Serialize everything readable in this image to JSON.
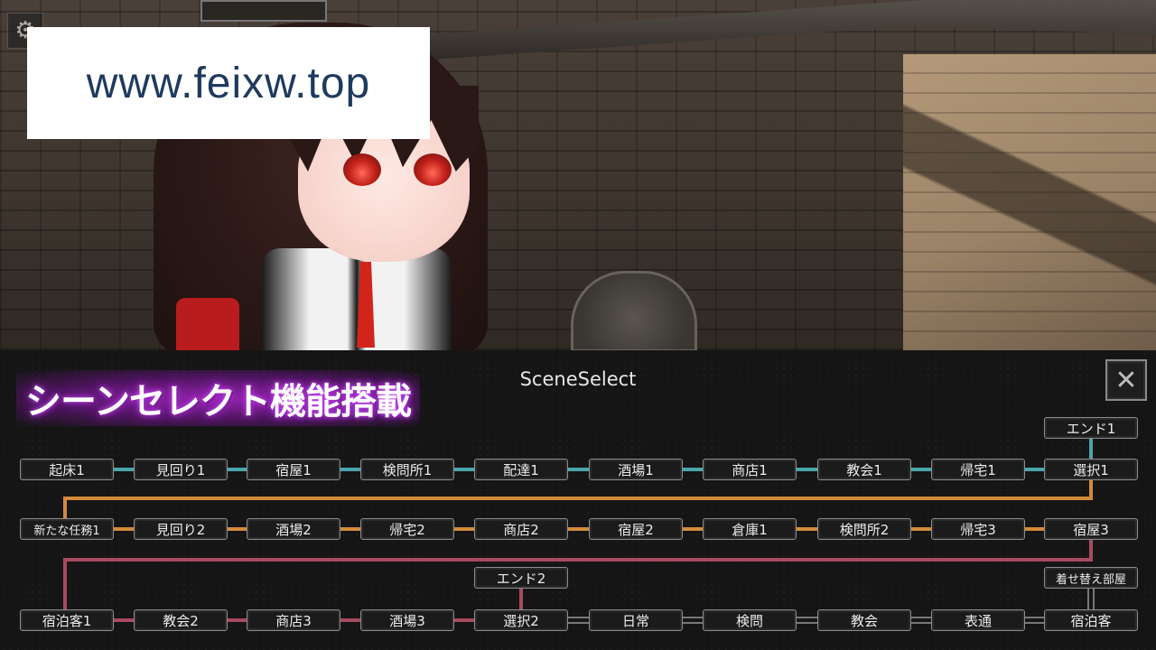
{
  "watermark": "www.feixw.top",
  "promo_banner": "シーンセレクト機能搭載",
  "panel": {
    "title": "SceneSelect",
    "close_symbol": "✕",
    "settings_symbol": "⚙"
  },
  "colors": {
    "row1_link": "#4aa6ad",
    "row2_link": "#d48a3a",
    "row3_link": "#a84a60",
    "neutral_link": "#9a9a9a"
  },
  "rows": {
    "row1": [
      "起床1",
      "見回り1",
      "宿屋1",
      "検問所1",
      "配達1",
      "酒場1",
      "商店1",
      "教会1",
      "帰宅1",
      "選択1"
    ],
    "row2": [
      "新たな任務1",
      "見回り2",
      "酒場2",
      "帰宅2",
      "商店2",
      "宿屋2",
      "倉庫1",
      "検問所2",
      "帰宅3",
      "宿屋3"
    ],
    "row3": [
      "宿泊客1",
      "教会2",
      "商店3",
      "酒場3",
      "選択2",
      "日常",
      "検問",
      "教会",
      "表通",
      "宿泊客"
    ]
  },
  "branches": {
    "end1": "エンド1",
    "end2": "エンド2",
    "dressing_room": "着せ替え部屋"
  }
}
